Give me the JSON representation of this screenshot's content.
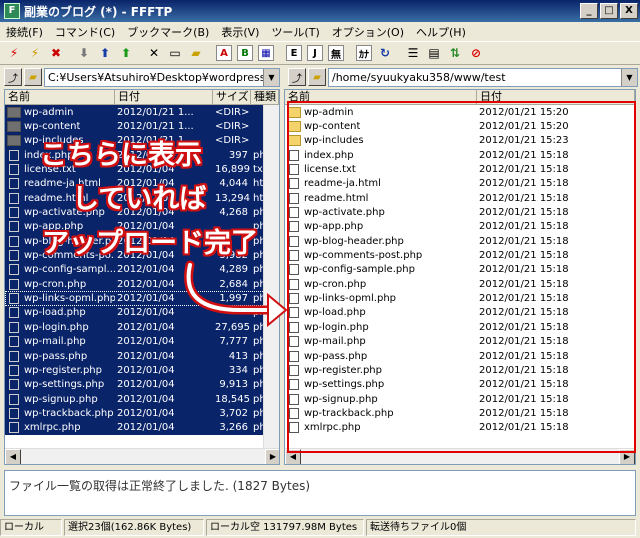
{
  "window": {
    "title": "副業のブログ (*) - FFFTP",
    "minimize": "_",
    "maximize": "□",
    "close": "X"
  },
  "menu": [
    "接続(F)",
    "コマンド(C)",
    "ブックマーク(B)",
    "表示(V)",
    "ツール(T)",
    "オプション(O)",
    "ヘルプ(H)"
  ],
  "toolbar": {
    "ascii_label": "A",
    "binary_label": "B",
    "euc_label": "E",
    "jis_label": "J",
    "none_label": "無",
    "kana_label": "ｶﾅ"
  },
  "local": {
    "path": "C:¥Users¥Atsuhiro¥Desktop¥wordpress",
    "headers": {
      "name": "名前",
      "date": "日付",
      "size": "サイズ",
      "type": "種類"
    },
    "files": [
      {
        "name": "wp-admin",
        "date": "2012/01/21 1...",
        "size": "<DIR>",
        "type": "",
        "kind": "folder"
      },
      {
        "name": "wp-content",
        "date": "2012/01/21 1...",
        "size": "<DIR>",
        "type": "",
        "kind": "folder"
      },
      {
        "name": "wp-includes",
        "date": "2012/01/21 1...",
        "size": "<DIR>",
        "type": "",
        "kind": "folder"
      },
      {
        "name": "index.php",
        "date": "2012/01/04",
        "size": "397",
        "type": "php",
        "kind": "file"
      },
      {
        "name": "license.txt",
        "date": "2012/01/04",
        "size": "16,899",
        "type": "txt",
        "kind": "file"
      },
      {
        "name": "readme-ja.html",
        "date": "2012/01/04",
        "size": "4,044",
        "type": "html",
        "kind": "file"
      },
      {
        "name": "readme.html",
        "date": "2012/01/04",
        "size": "13,294",
        "type": "html",
        "kind": "file"
      },
      {
        "name": "wp-activate.php",
        "date": "2012/01/04",
        "size": "4,268",
        "type": "php",
        "kind": "file"
      },
      {
        "name": "wp-app.php",
        "date": "2012/01/04",
        "size": "",
        "type": "php",
        "kind": "file"
      },
      {
        "name": "wp-blog-header.php",
        "date": "2012/01/04",
        "size": "",
        "type": "php",
        "kind": "file"
      },
      {
        "name": "wp-comments-po...",
        "date": "2012/01/04",
        "size": "3,982",
        "type": "php",
        "kind": "file"
      },
      {
        "name": "wp-config-sampl...",
        "date": "2012/01/04",
        "size": "4,289",
        "type": "php",
        "kind": "file"
      },
      {
        "name": "wp-cron.php",
        "date": "2012/01/04",
        "size": "2,684",
        "type": "php",
        "kind": "file"
      },
      {
        "name": "wp-links-opml.php",
        "date": "2012/01/04",
        "size": "1,997",
        "type": "php",
        "kind": "file",
        "focus": true
      },
      {
        "name": "wp-load.php",
        "date": "2012/01/04",
        "size": "",
        "type": "php",
        "kind": "file"
      },
      {
        "name": "wp-login.php",
        "date": "2012/01/04",
        "size": "27,695",
        "type": "php",
        "kind": "file"
      },
      {
        "name": "wp-mail.php",
        "date": "2012/01/04",
        "size": "7,777",
        "type": "php",
        "kind": "file"
      },
      {
        "name": "wp-pass.php",
        "date": "2012/01/04",
        "size": "413",
        "type": "php",
        "kind": "file"
      },
      {
        "name": "wp-register.php",
        "date": "2012/01/04",
        "size": "334",
        "type": "php",
        "kind": "file"
      },
      {
        "name": "wp-settings.php",
        "date": "2012/01/04",
        "size": "9,913",
        "type": "php",
        "kind": "file"
      },
      {
        "name": "wp-signup.php",
        "date": "2012/01/04",
        "size": "18,545",
        "type": "php",
        "kind": "file"
      },
      {
        "name": "wp-trackback.php",
        "date": "2012/01/04",
        "size": "3,702",
        "type": "php",
        "kind": "file"
      },
      {
        "name": "xmlrpc.php",
        "date": "2012/01/04",
        "size": "3,266",
        "type": "php",
        "kind": "file"
      }
    ]
  },
  "remote": {
    "path": "/home/syuukyaku358/www/test",
    "headers": {
      "name": "名前",
      "date": "日付"
    },
    "files": [
      {
        "name": "wp-admin",
        "date": "2012/01/21 15:20",
        "kind": "folder"
      },
      {
        "name": "wp-content",
        "date": "2012/01/21 15:20",
        "kind": "folder"
      },
      {
        "name": "wp-includes",
        "date": "2012/01/21 15:23",
        "kind": "folder"
      },
      {
        "name": "index.php",
        "date": "2012/01/21 15:18",
        "kind": "file"
      },
      {
        "name": "license.txt",
        "date": "2012/01/21 15:18",
        "kind": "file"
      },
      {
        "name": "readme-ja.html",
        "date": "2012/01/21 15:18",
        "kind": "file"
      },
      {
        "name": "readme.html",
        "date": "2012/01/21 15:18",
        "kind": "file"
      },
      {
        "name": "wp-activate.php",
        "date": "2012/01/21 15:18",
        "kind": "file"
      },
      {
        "name": "wp-app.php",
        "date": "2012/01/21 15:18",
        "kind": "file"
      },
      {
        "name": "wp-blog-header.php",
        "date": "2012/01/21 15:18",
        "kind": "file"
      },
      {
        "name": "wp-comments-post.php",
        "date": "2012/01/21 15:18",
        "kind": "file"
      },
      {
        "name": "wp-config-sample.php",
        "date": "2012/01/21 15:18",
        "kind": "file"
      },
      {
        "name": "wp-cron.php",
        "date": "2012/01/21 15:18",
        "kind": "file"
      },
      {
        "name": "wp-links-opml.php",
        "date": "2012/01/21 15:18",
        "kind": "file"
      },
      {
        "name": "wp-load.php",
        "date": "2012/01/21 15:18",
        "kind": "file"
      },
      {
        "name": "wp-login.php",
        "date": "2012/01/21 15:18",
        "kind": "file"
      },
      {
        "name": "wp-mail.php",
        "date": "2012/01/21 15:18",
        "kind": "file"
      },
      {
        "name": "wp-pass.php",
        "date": "2012/01/21 15:18",
        "kind": "file"
      },
      {
        "name": "wp-register.php",
        "date": "2012/01/21 15:18",
        "kind": "file"
      },
      {
        "name": "wp-settings.php",
        "date": "2012/01/21 15:18",
        "kind": "file"
      },
      {
        "name": "wp-signup.php",
        "date": "2012/01/21 15:18",
        "kind": "file"
      },
      {
        "name": "wp-trackback.php",
        "date": "2012/01/21 15:18",
        "kind": "file"
      },
      {
        "name": "xmlrpc.php",
        "date": "2012/01/21 15:18",
        "kind": "file"
      }
    ]
  },
  "annotation": {
    "line1": "こちらに表示",
    "line2": "していれば",
    "line3": "アップロード完了",
    "color": "#d01010"
  },
  "log": {
    "message": "ファイル一覧の取得は正常終了しました. (1827 Bytes)"
  },
  "status": {
    "mode": "ローカル",
    "selection": "選択23個(162.86K Bytes)",
    "free": "ローカル空 131797.98M Bytes",
    "queue": "転送待ちファイル0個"
  },
  "colors": {
    "selection": "#0a246a",
    "accent": "#e00000"
  }
}
